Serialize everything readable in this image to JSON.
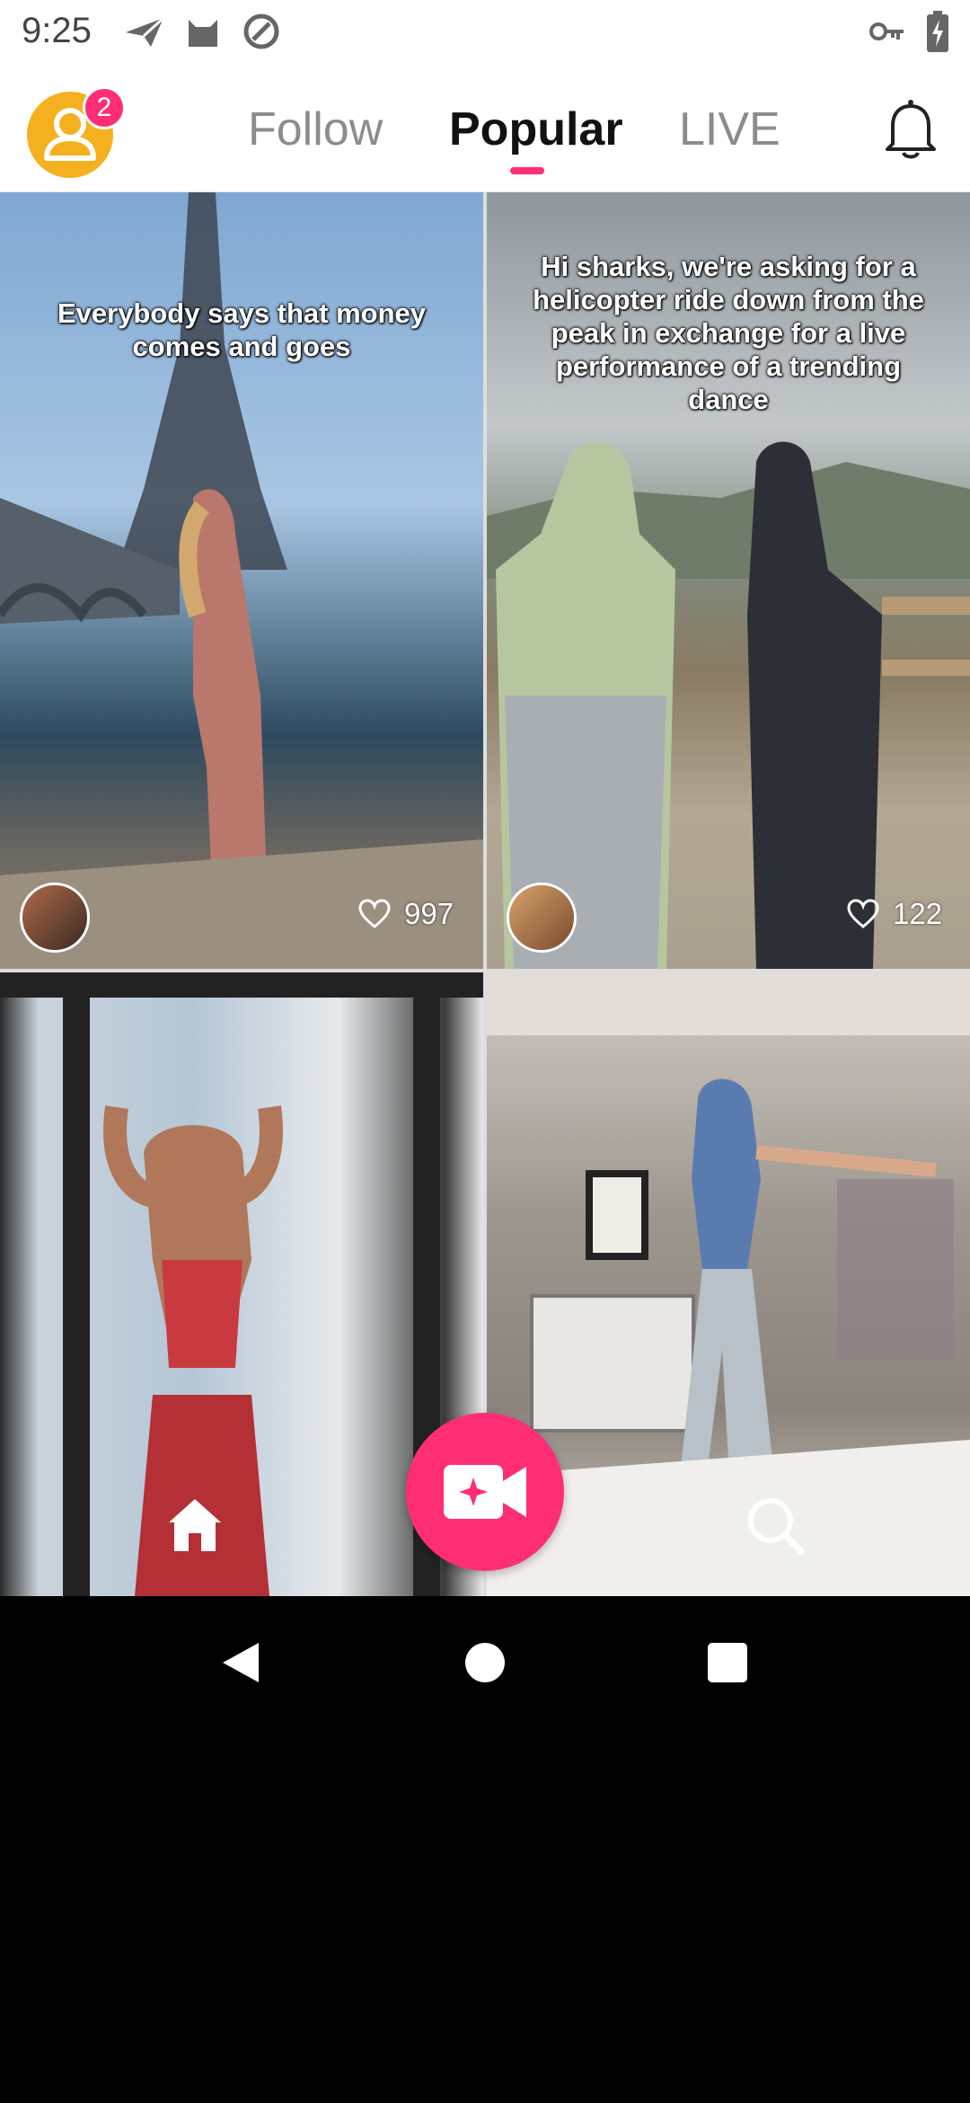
{
  "status_bar": {
    "time": "9:25",
    "left_icons": [
      "send-icon",
      "cat-icon",
      "at-sign-icon"
    ],
    "right_icons": [
      "key-icon",
      "battery-charging-icon"
    ]
  },
  "header": {
    "notification_badge": "2",
    "tabs": [
      {
        "label": "Follow",
        "active": false
      },
      {
        "label": "Popular",
        "active": true
      },
      {
        "label": "LIVE",
        "active": false
      }
    ],
    "accent_color": "#FF2E74",
    "avatar_color": "#F5B020"
  },
  "feed": {
    "items": [
      {
        "caption": "Everybody says that money comes and goes",
        "likes": "997",
        "has_avatar": true
      },
      {
        "caption": "Hi sharks, we're asking for a helicopter ride down from the peak in exchange for a live performance of a trending dance",
        "likes": "122",
        "has_avatar": true
      },
      {
        "caption": "",
        "likes": "",
        "has_avatar": false
      },
      {
        "caption": "",
        "likes": "",
        "has_avatar": false
      }
    ]
  },
  "bottom_nav": {
    "items": [
      "home-icon",
      "record-video-icon",
      "search-icon"
    ]
  },
  "system_nav": [
    "back-icon",
    "home-circle-icon",
    "recents-icon"
  ]
}
